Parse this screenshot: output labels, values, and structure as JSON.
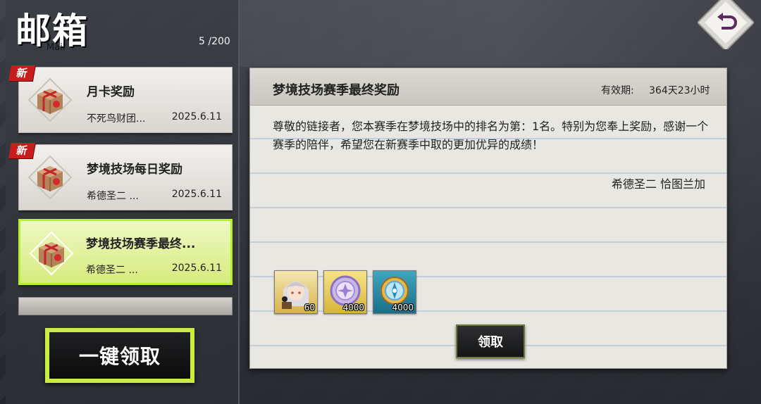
{
  "header": {
    "title": "邮箱",
    "subtitle": "Mail",
    "count": "5 /200"
  },
  "mail_list": [
    {
      "subject": "月卡奖励",
      "sender": "不死鸟财团...",
      "date": "2025.6.11",
      "badge": "新",
      "selected": false
    },
    {
      "subject": "梦境技场每日奖励",
      "sender": "希德圣二 ...",
      "date": "2025.6.11",
      "badge": "新",
      "selected": false
    },
    {
      "subject": "梦境技场赛季最终...",
      "sender": "希德圣二 ...",
      "date": "2025.6.11",
      "badge": "",
      "selected": true
    }
  ],
  "claim_all_label": "一键领取",
  "detail": {
    "title": "梦境技场赛季最终奖励",
    "valid_label": "有效期:",
    "valid_value": "364天23小时",
    "body": "尊敬的链接者，您本赛季在梦境技场中的排名为第：1名。特别为您奉上奖励，感谢一个赛季的陪伴，希望您在新赛季中取的更加优异的成绩！",
    "signature": "希德圣二 恰图兰加",
    "rewards": [
      {
        "icon": "character-portrait",
        "qty": "60"
      },
      {
        "icon": "purple-medal",
        "qty": "4000"
      },
      {
        "icon": "blue-compass-gem",
        "qty": "4000"
      }
    ],
    "claim_label": "领取"
  }
}
